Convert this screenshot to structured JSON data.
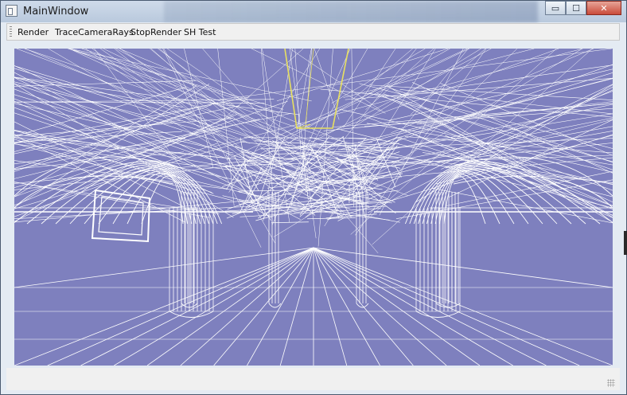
{
  "window": {
    "title": "MainWindow"
  },
  "caption": {
    "minimize": "▭",
    "maximize": "☐",
    "close": "✕"
  },
  "toolbar": {
    "items": [
      "Render",
      "TraceCameraRays",
      "StopRender",
      "SH Test"
    ]
  },
  "viewport": {
    "background": "#7e80be",
    "line_color": "#ffffff",
    "highlight_color": "#e8e060"
  }
}
